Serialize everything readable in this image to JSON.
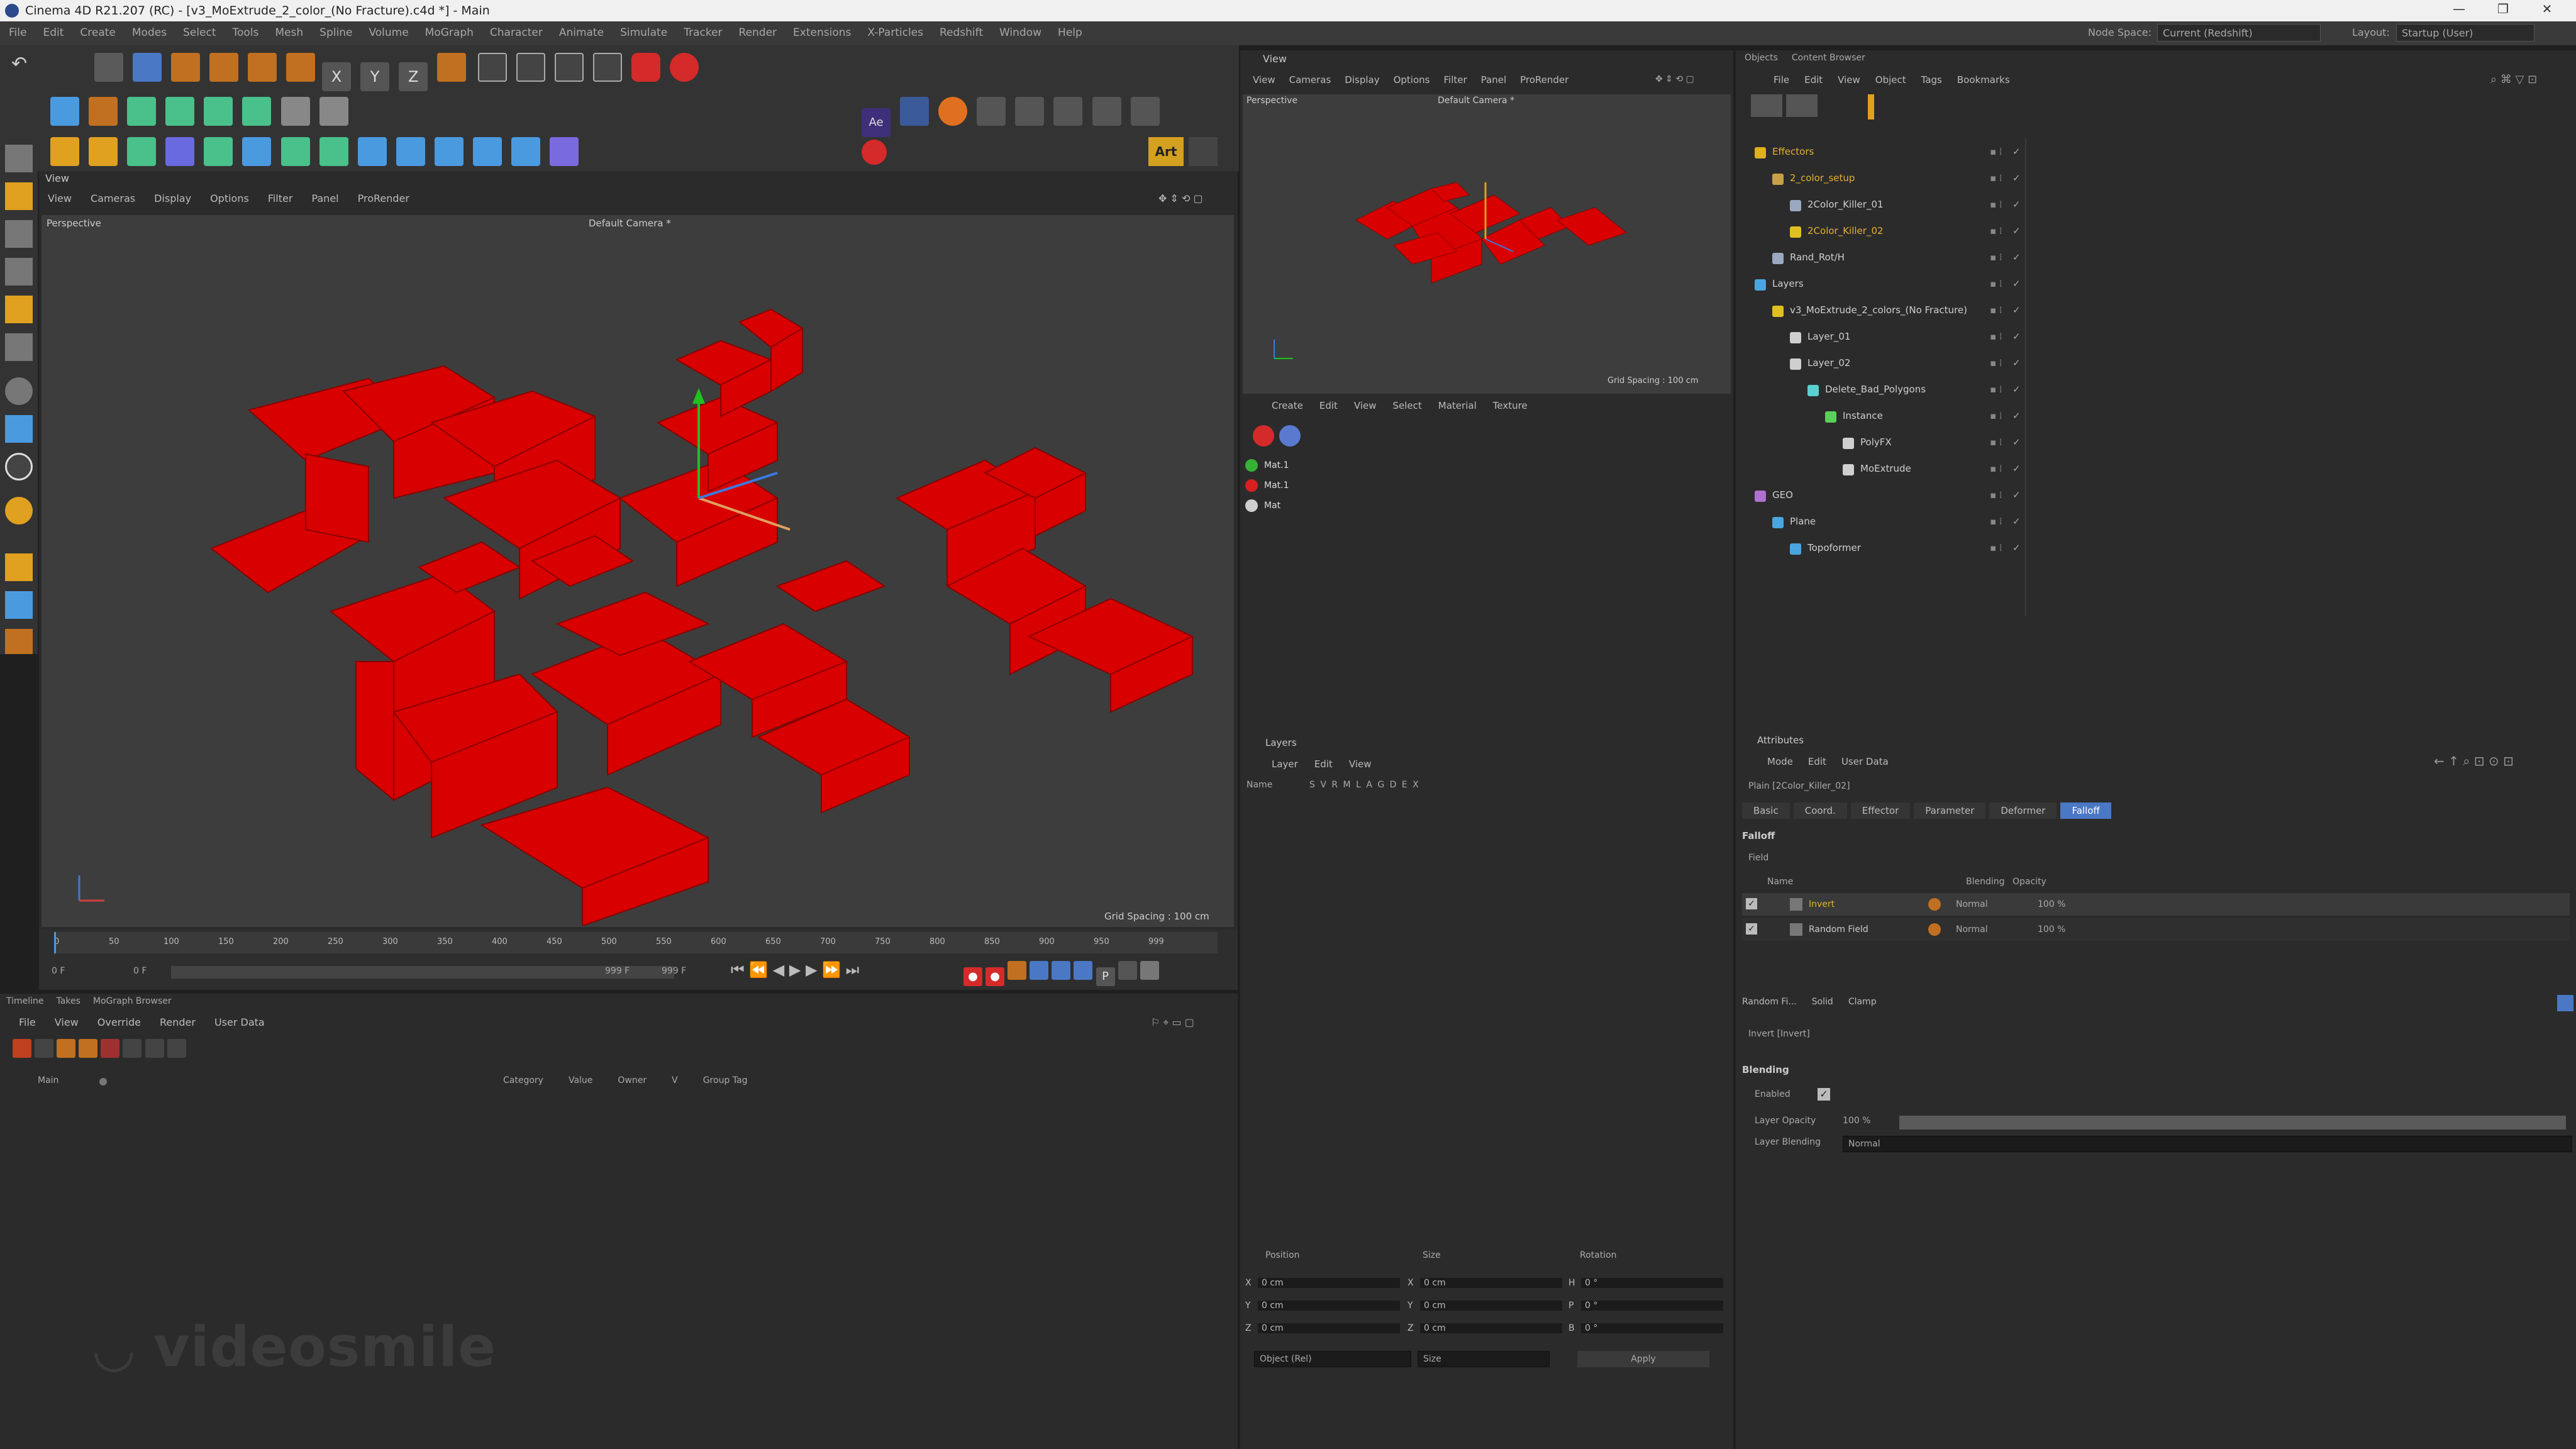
{
  "titlebar": {
    "title": "Cinema 4D R21.207 (RC) - [v3_MoExtrude_2_color_(No Fracture).c4d *] - Main",
    "minimize": "—",
    "restore": "❐",
    "close": "✕"
  },
  "menubar": {
    "items": [
      "File",
      "Edit",
      "Create",
      "Modes",
      "Select",
      "Tools",
      "Mesh",
      "Spline",
      "Volume",
      "MoGraph",
      "Character",
      "Animate",
      "Simulate",
      "Tracker",
      "Render",
      "Extensions",
      "X-Particles",
      "Redshift",
      "Window",
      "Help"
    ],
    "node_space_label": "Node Space:",
    "node_space_value": "Current (Redshift)",
    "layout_label": "Layout:",
    "layout_value": "Startup (User)"
  },
  "main_view": {
    "panel_label": "View",
    "menu": [
      "View",
      "Cameras",
      "Display",
      "Options",
      "Filter",
      "Panel",
      "ProRender"
    ],
    "projection": "Perspective",
    "camera": "Default Camera *",
    "grid_spacing": "Grid Spacing : 100 cm"
  },
  "timeline": {
    "ticks": [
      "0",
      "50",
      "100",
      "150",
      "200",
      "250",
      "300",
      "350",
      "400",
      "450",
      "500",
      "550",
      "600",
      "650",
      "700",
      "750",
      "800",
      "850",
      "900",
      "950",
      "999"
    ],
    "current_frame": "0 F",
    "start_frame": "0 F",
    "end_frame": "999 F",
    "end_frame2": "999 F",
    "frame_readout": "0 F"
  },
  "bottom_left": {
    "tabs": [
      "Timeline",
      "Takes",
      "MoGraph Browser"
    ],
    "menu": [
      "File",
      "View",
      "Override",
      "Render",
      "User Data"
    ],
    "columns": [
      "Category",
      "Value",
      "Owner",
      "V",
      "Group Tag"
    ],
    "take_main": "Main"
  },
  "watermark": "videosmile",
  "small_view": {
    "panel_label": "View",
    "menu": [
      "View",
      "Cameras",
      "Display",
      "Options",
      "Filter",
      "Panel",
      "ProRender"
    ],
    "projection": "Perspective",
    "camera": "Default Camera *",
    "grid_spacing": "Grid Spacing : 100 cm"
  },
  "materials": {
    "menu": [
      "Create",
      "Edit",
      "View",
      "Select",
      "Material",
      "Texture"
    ],
    "items": [
      {
        "name": "Mat.1",
        "color": "#36b336"
      },
      {
        "name": "Mat.1",
        "color": "#d82020"
      },
      {
        "name": "Mat",
        "color": "#cfcfcf"
      }
    ]
  },
  "layers": {
    "panel_label": "Layers",
    "menu": [
      "Layer",
      "Edit",
      "View"
    ],
    "name_col": "Name",
    "flags": "S V R M L A G D E X"
  },
  "coords": {
    "headers": [
      "Position",
      "Size",
      "Rotation"
    ],
    "rows": [
      {
        "axis": "X",
        "pos": "0 cm",
        "size_axis": "X",
        "size": "0 cm",
        "rot_axis": "H",
        "rot": "0 °"
      },
      {
        "axis": "Y",
        "pos": "0 cm",
        "size_axis": "Y",
        "size": "0 cm",
        "rot_axis": "P",
        "rot": "0 °"
      },
      {
        "axis": "Z",
        "pos": "0 cm",
        "size_axis": "Z",
        "size": "0 cm",
        "rot_axis": "B",
        "rot": "0 °"
      }
    ],
    "mode1": "Object (Rel)",
    "mode2": "Size",
    "apply": "Apply"
  },
  "objects": {
    "tabs": [
      "Objects",
      "Content Browser"
    ],
    "menu": [
      "File",
      "Edit",
      "View",
      "Object",
      "Tags",
      "Bookmarks"
    ],
    "tree": [
      {
        "name": "Effectors",
        "indent": 0,
        "color": "#e0b020",
        "highlight": true
      },
      {
        "name": "2_color_setup",
        "indent": 1,
        "color": "#c9a04a",
        "highlight": true
      },
      {
        "name": "2Color_Killer_01",
        "indent": 2,
        "color": "#9aa8c0",
        "highlight": false
      },
      {
        "name": "2Color_Killer_02",
        "indent": 2,
        "color": "#e0c020",
        "highlight": true
      },
      {
        "name": "Rand_Rot/H",
        "indent": 1,
        "color": "#9aa8c0",
        "highlight": false
      },
      {
        "name": "Layers",
        "indent": 0,
        "color": "#4aa6e0",
        "highlight": false
      },
      {
        "name": "v3_MoExtrude_2_colors_(No Fracture)",
        "indent": 1,
        "color": "#e0c020",
        "highlight": false
      },
      {
        "name": "Layer_01",
        "indent": 2,
        "color": "#cfcfcf",
        "highlight": false
      },
      {
        "name": "Layer_02",
        "indent": 2,
        "color": "#cfcfcf",
        "highlight": false
      },
      {
        "name": "Delete_Bad_Polygons",
        "indent": 3,
        "color": "#5ad0d0",
        "highlight": false
      },
      {
        "name": "Instance",
        "indent": 4,
        "color": "#5ad05a",
        "highlight": false
      },
      {
        "name": "PolyFX",
        "indent": 5,
        "color": "#cfcfcf",
        "highlight": false
      },
      {
        "name": "MoExtrude",
        "indent": 5,
        "color": "#cfcfcf",
        "highlight": false
      },
      {
        "name": "GEO",
        "indent": 0,
        "color": "#b070d0",
        "highlight": false
      },
      {
        "name": "Plane",
        "indent": 1,
        "color": "#4aa6e0",
        "highlight": false
      },
      {
        "name": "Topoformer",
        "indent": 2,
        "color": "#4aa6e0",
        "highlight": false
      }
    ]
  },
  "attributes": {
    "panel_label": "Attributes",
    "menu": [
      "Mode",
      "Edit",
      "User Data"
    ],
    "object_title": "Plain [2Color_Killer_02]",
    "tabs": [
      "Basic",
      "Coord.",
      "Effector",
      "Parameter",
      "Deformer",
      "Falloff"
    ],
    "active_tab": "Falloff",
    "section": "Falloff",
    "field_label": "Field",
    "columns": [
      "Name",
      "Blending",
      "Opacity"
    ],
    "rows": [
      {
        "name": "Invert",
        "blending": "Normal",
        "opacity": "100 %",
        "highlight": true
      },
      {
        "name": "Random Field",
        "blending": "Normal",
        "opacity": "100 %",
        "highlight": false
      }
    ],
    "tool_tabs": [
      "Random Fi...",
      "Solid",
      "Clamp"
    ],
    "layer_title": "Invert [Invert]",
    "blending_section": "Blending",
    "enabled_label": "Enabled",
    "opacity_label": "Layer Opacity",
    "opacity_value": "100 %",
    "opacity_fill": 1.0,
    "blending_label": "Layer Blending",
    "blending_value": "Normal"
  },
  "colors": {
    "accent": "#4a78c4",
    "cube_red": "#d80000",
    "highlight_text": "#e6b030"
  }
}
